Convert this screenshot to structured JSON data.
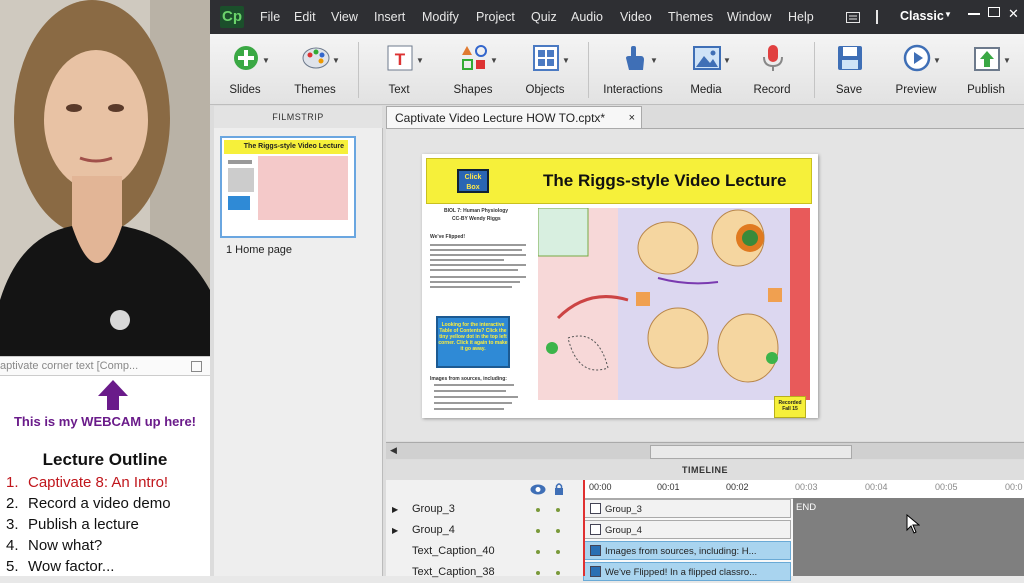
{
  "webcam": {
    "corner_text": "aptivate corner text [Comp...",
    "note": "This is my WEBCAM up here!"
  },
  "outline": {
    "title": "Lecture Outline",
    "items": [
      {
        "num": "1.",
        "label": "Captivate 8: An Intro!",
        "active": true
      },
      {
        "num": "2.",
        "label": "Record a video demo",
        "active": false
      },
      {
        "num": "3.",
        "label": "Publish a lecture",
        "active": false
      },
      {
        "num": "4.",
        "label": "Now what?",
        "active": false
      },
      {
        "num": "5.",
        "label": "Wow factor...",
        "active": false
      }
    ]
  },
  "app": {
    "logo": "Cp",
    "menu": [
      "File",
      "Edit",
      "View",
      "Insert",
      "Modify",
      "Project",
      "Quiz",
      "Audio",
      "Video",
      "Themes",
      "Window",
      "Help"
    ],
    "workspace": "Classic",
    "toolbar": [
      "Slides",
      "Themes",
      "Text",
      "Shapes",
      "Objects",
      "Interactions",
      "Media",
      "Record",
      "Save",
      "Preview",
      "Publish"
    ]
  },
  "filmstrip": {
    "header": "FILMSTRIP",
    "slide_label": "1 Home page",
    "thumb_title": "The Riggs-style Video Lecture"
  },
  "document": {
    "tab": "Captivate Video Lecture HOW TO.cptx*",
    "close": "×"
  },
  "slide": {
    "title": "The Riggs-style Video Lecture",
    "clickbox": "Click Box",
    "subtitle1": "BIOL 7: Human Physiology",
    "subtitle2": "CC-BY Wendy Riggs",
    "flipped_heading": "We've Flipped!",
    "bluebox": "Looking for the interactive Table of Contents? Click the tiny yellow dot in the top left corner. Click it again to make it go away.",
    "sources_heading": "Images from sources, including:",
    "recorded": "Recorded Fall 15"
  },
  "timeline": {
    "header": "TIMELINE",
    "ticks": [
      "00:00",
      "00:01",
      "00:02",
      "00:03",
      "00:04",
      "00:05",
      "00:0"
    ],
    "end_label": "END",
    "rows": [
      {
        "name": "Group_3",
        "expandable": true,
        "track": "Group_3",
        "kind": "grp"
      },
      {
        "name": "Group_4",
        "expandable": true,
        "track": "Group_4",
        "kind": "grp"
      },
      {
        "name": "Text_Caption_40",
        "expandable": false,
        "track": "Images from sources, including:  H...",
        "kind": "cap"
      },
      {
        "name": "Text_Caption_38",
        "expandable": false,
        "track": "We've Flipped!  In a flipped classro...",
        "kind": "cap"
      }
    ]
  }
}
